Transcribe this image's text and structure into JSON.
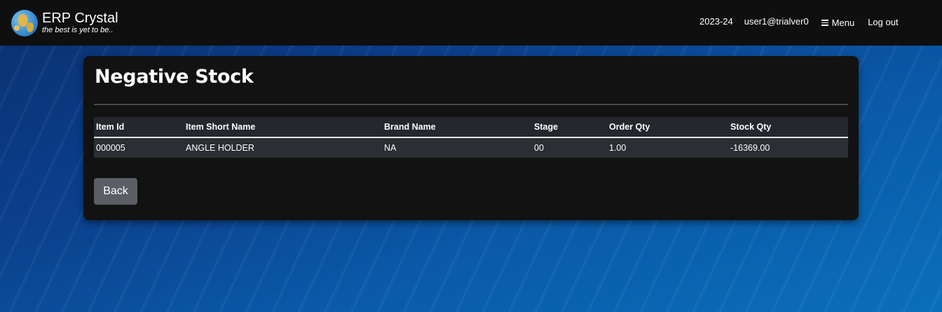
{
  "header": {
    "app_title": "ERP Crystal",
    "tagline": "the best is yet to be..",
    "fiscal_year": "2023-24",
    "user": "user1@trialver0",
    "menu_label": "Menu",
    "logout_label": "Log out"
  },
  "page": {
    "title": "Negative Stock",
    "back_label": "Back"
  },
  "table": {
    "columns": [
      "Item Id",
      "Item Short Name",
      "Brand Name",
      "Stage",
      "Order Qty",
      "Stock Qty"
    ],
    "rows": [
      [
        "000005",
        "ANGLE HOLDER",
        "NA",
        "00",
        "1.00",
        "-16369.00"
      ]
    ]
  },
  "colors": {
    "navbar_bg": "#0f0f10",
    "card_bg": "#121212",
    "header_row_bg": "#24272c",
    "data_row_bg": "#2b2e33",
    "button_bg": "#5b5e64"
  }
}
